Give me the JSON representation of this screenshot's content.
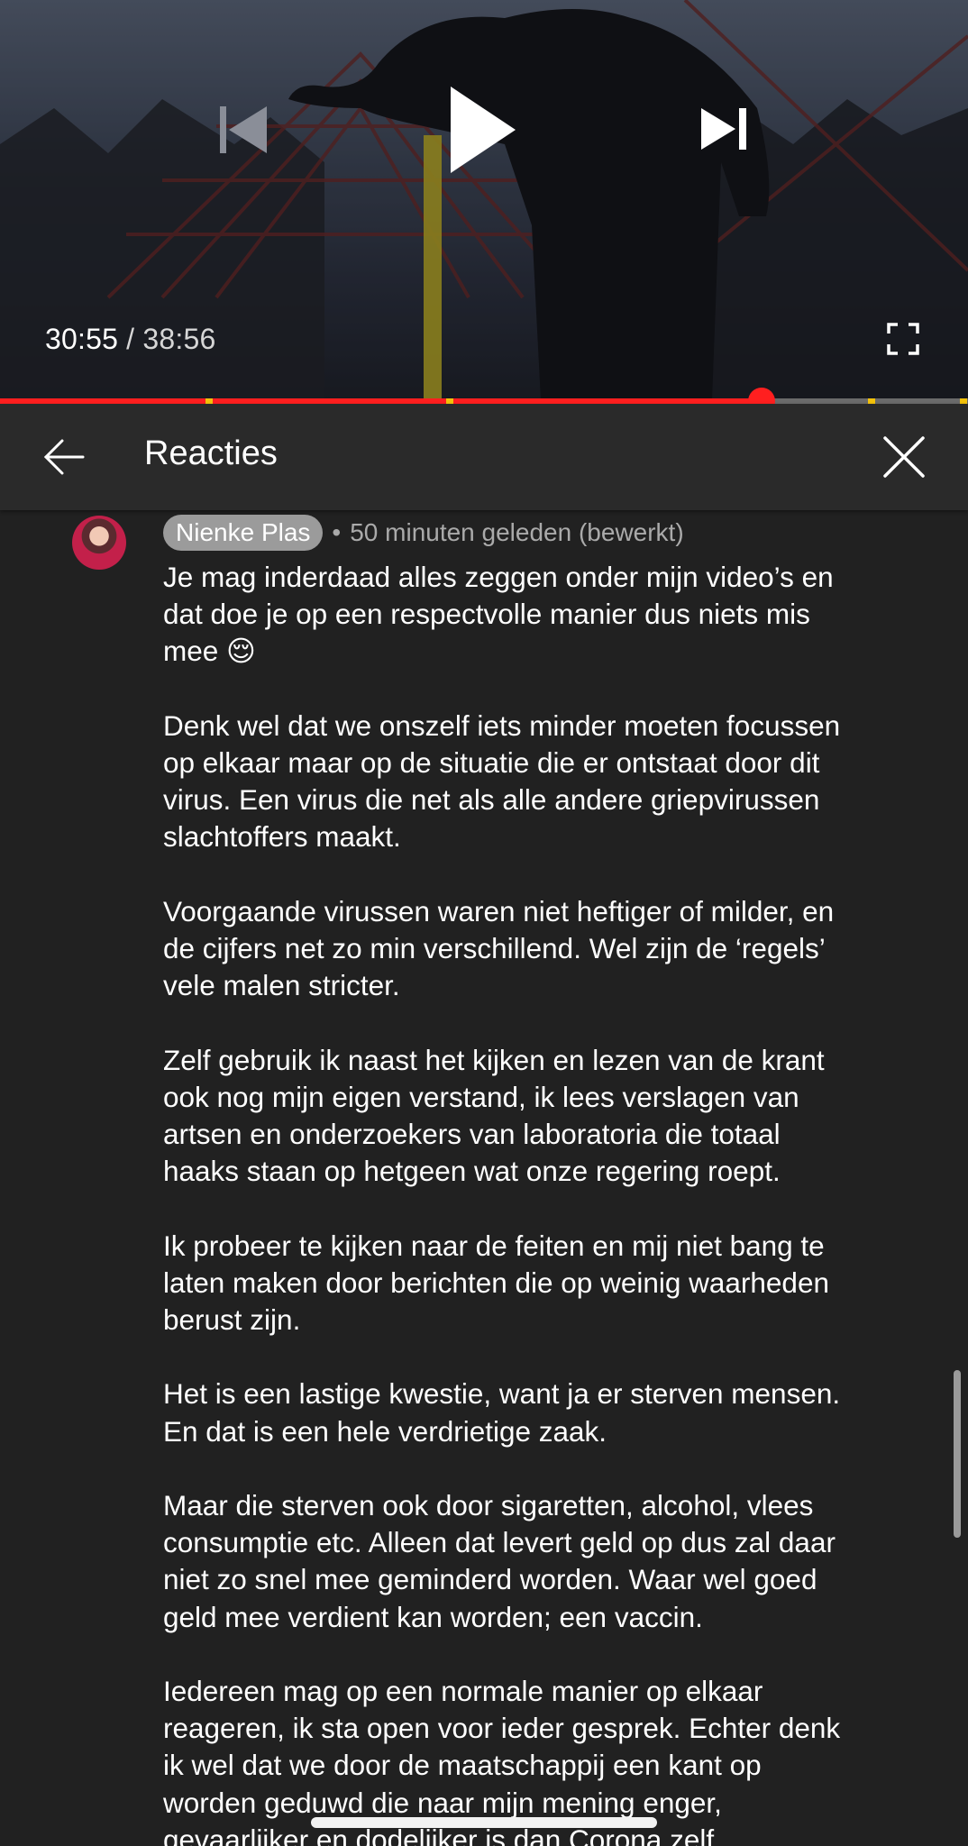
{
  "player": {
    "current_time": "30:55",
    "separator": "/",
    "duration": "38:56",
    "progress_fraction": 0.787,
    "chapter_markers_fraction": [
      0.216,
      0.465,
      0.9,
      0.995
    ],
    "icons": {
      "previous": "skip-previous-icon",
      "play": "play-icon",
      "next": "skip-next-icon",
      "fullscreen": "fullscreen-icon"
    }
  },
  "comments_panel": {
    "title": "Reacties",
    "back_icon": "arrow-left-icon",
    "close_icon": "close-icon"
  },
  "comment": {
    "author": "Nienke Plas",
    "dot": "•",
    "time": "50 minuten geleden (bewerkt)",
    "paragraphs": [
      "Je mag inderdaad alles zeggen onder mijn video’s en\ndat doe je op een respectvolle manier dus niets mis\nmee 😌",
      "Denk wel dat we onszelf iets minder moeten focussen\nop elkaar maar op de situatie die er ontstaat door dit\nvirus. Een virus die net als alle andere griepvirussen\nslachtoffers maakt.",
      "Voorgaande virussen waren niet heftiger of milder, en\nde cijfers net zo min verschillend. Wel zijn de ‘regels’\nvele malen stricter.",
      "Zelf gebruik ik naast het kijken en lezen van de krant\nook nog mijn eigen verstand, ik lees verslagen van\nartsen en onderzoekers van laboratoria die totaal\nhaaks staan op hetgeen wat onze regering roept.",
      "Ik probeer te kijken naar de feiten en mij  niet bang te\nlaten maken door berichten die op weinig waarheden\nberust zijn.",
      "Het is een lastige kwestie, want ja er sterven mensen.\nEn dat is een hele verdrietige zaak.",
      "Maar die sterven ook door sigaretten, alcohol, vlees\nconsumptie etc. Alleen dat levert geld op dus zal daar\nniet zo snel mee geminderd worden. Waar wel goed\ngeld mee verdient kan worden; een vaccin.",
      "Iedereen mag op een normale manier op elkaar\nreageren, ik sta open voor ieder gesprek. Echter denk\nik wel dat we door de maatschappij een kant op\nworden geduwd die naar mijn mening enger,\ngevaarlijker en dodelijker is dan Corona zelf."
    ]
  }
}
